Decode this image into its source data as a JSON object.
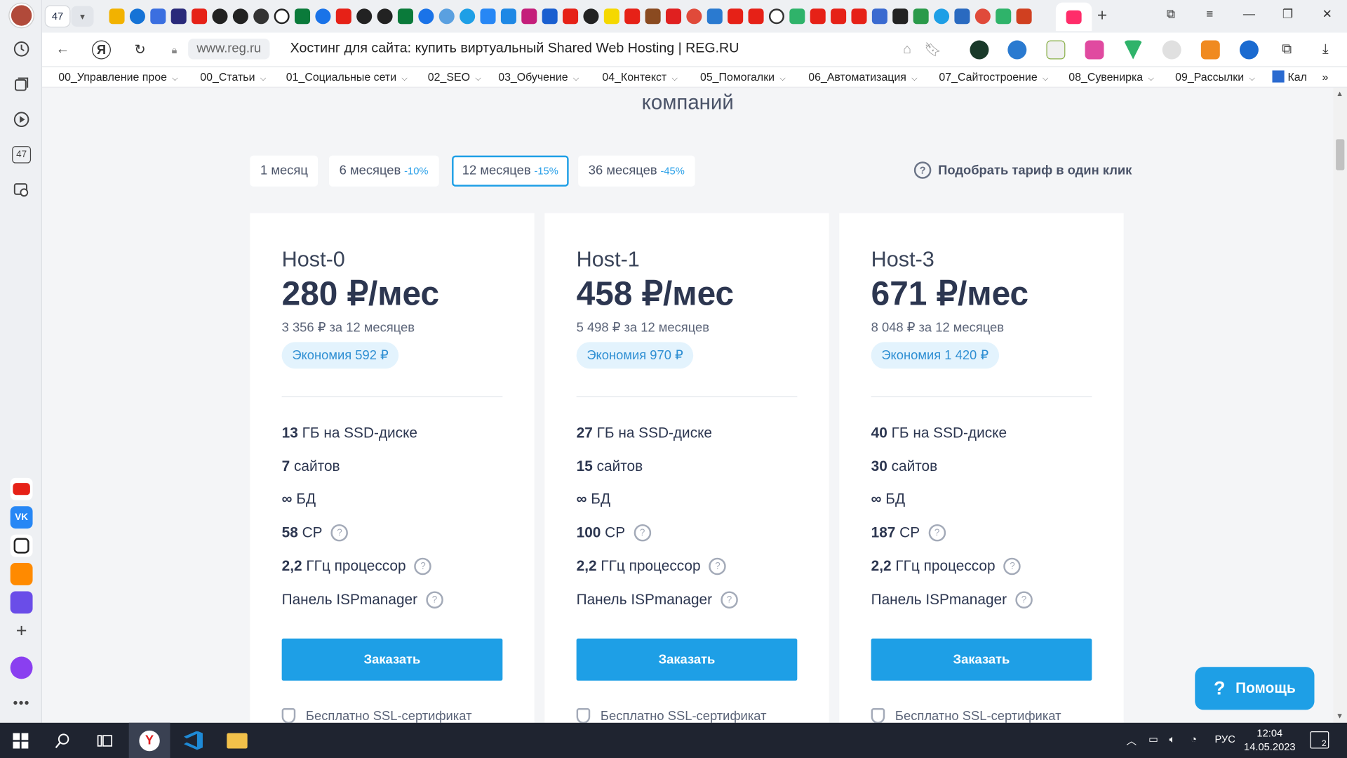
{
  "browser": {
    "tab_count": "47",
    "url": "www.reg.ru",
    "title": "Хостинг для сайта: купить виртуальный Shared Web Hosting | REG.RU"
  },
  "rail": {
    "tab_count": "47"
  },
  "bookmarks": [
    {
      "label": "00_Управление прое"
    },
    {
      "label": "00_Статьи"
    },
    {
      "label": "01_Социальные сети"
    },
    {
      "label": "02_SEO"
    },
    {
      "label": "03_Обучение"
    },
    {
      "label": "04_Контекст"
    },
    {
      "label": "05_Помогалки"
    },
    {
      "label": "06_Автоматизация"
    },
    {
      "label": "07_Сайтостроение"
    },
    {
      "label": "08_Сувенирка"
    },
    {
      "label": "09_Рассылки"
    },
    {
      "label": "Кал"
    }
  ],
  "page": {
    "header_fragment": "компаний",
    "periods": [
      {
        "label": "1 месяц",
        "discount": ""
      },
      {
        "label": "6 месяцев",
        "discount": "-10%"
      },
      {
        "label": "12 месяцев",
        "discount": "-15%"
      },
      {
        "label": "36 месяцев",
        "discount": "-45%"
      }
    ],
    "pick_label": "Подобрать тариф в один клик",
    "plans": [
      {
        "name": "Host-0",
        "price": "280 ₽/мес",
        "total": "3 356 ₽ за 12 месяцев",
        "savings": "Экономия 592 ₽",
        "disk_value": "13",
        "disk_label": "ГБ на SSD-диске",
        "sites_value": "7",
        "sites_label": "сайтов",
        "db_value": "∞",
        "db_label": "БД",
        "cp_value": "58",
        "cp_label": "CP",
        "cpu_value": "2,2",
        "cpu_label": "ГГц процессор",
        "panel": "Панель ISPmanager",
        "order": "Заказать",
        "ssl": "Бесплатно SSL-сертификат"
      },
      {
        "name": "Host-1",
        "price": "458 ₽/мес",
        "total": "5 498 ₽ за 12 месяцев",
        "savings": "Экономия 970 ₽",
        "disk_value": "27",
        "disk_label": "ГБ на SSD-диске",
        "sites_value": "15",
        "sites_label": "сайтов",
        "db_value": "∞",
        "db_label": "БД",
        "cp_value": "100",
        "cp_label": "CP",
        "cpu_value": "2,2",
        "cpu_label": "ГГц процессор",
        "panel": "Панель ISPmanager",
        "order": "Заказать",
        "ssl": "Бесплатно SSL-сертификат"
      },
      {
        "name": "Host-3",
        "price": "671 ₽/мес",
        "total": "8 048 ₽ за 12 месяцев",
        "savings": "Экономия 1 420 ₽",
        "disk_value": "40",
        "disk_label": "ГБ на SSD-диске",
        "sites_value": "30",
        "sites_label": "сайтов",
        "db_value": "∞",
        "db_label": "БД",
        "cp_value": "187",
        "cp_label": "CP",
        "cpu_value": "2,2",
        "cpu_label": "ГГц процессор",
        "panel": "Панель ISPmanager",
        "order": "Заказать",
        "ssl": "Бесплатно SSL-сертификат"
      }
    ],
    "help": "Помощь"
  },
  "taskbar": {
    "lang": "РУС",
    "time": "12:04",
    "date": "14.05.2023",
    "notifications": "2"
  },
  "colors": {
    "accent": "#1e9fe6",
    "discount": "#2aa0e8",
    "savings_bg": "#e3f3fd"
  }
}
